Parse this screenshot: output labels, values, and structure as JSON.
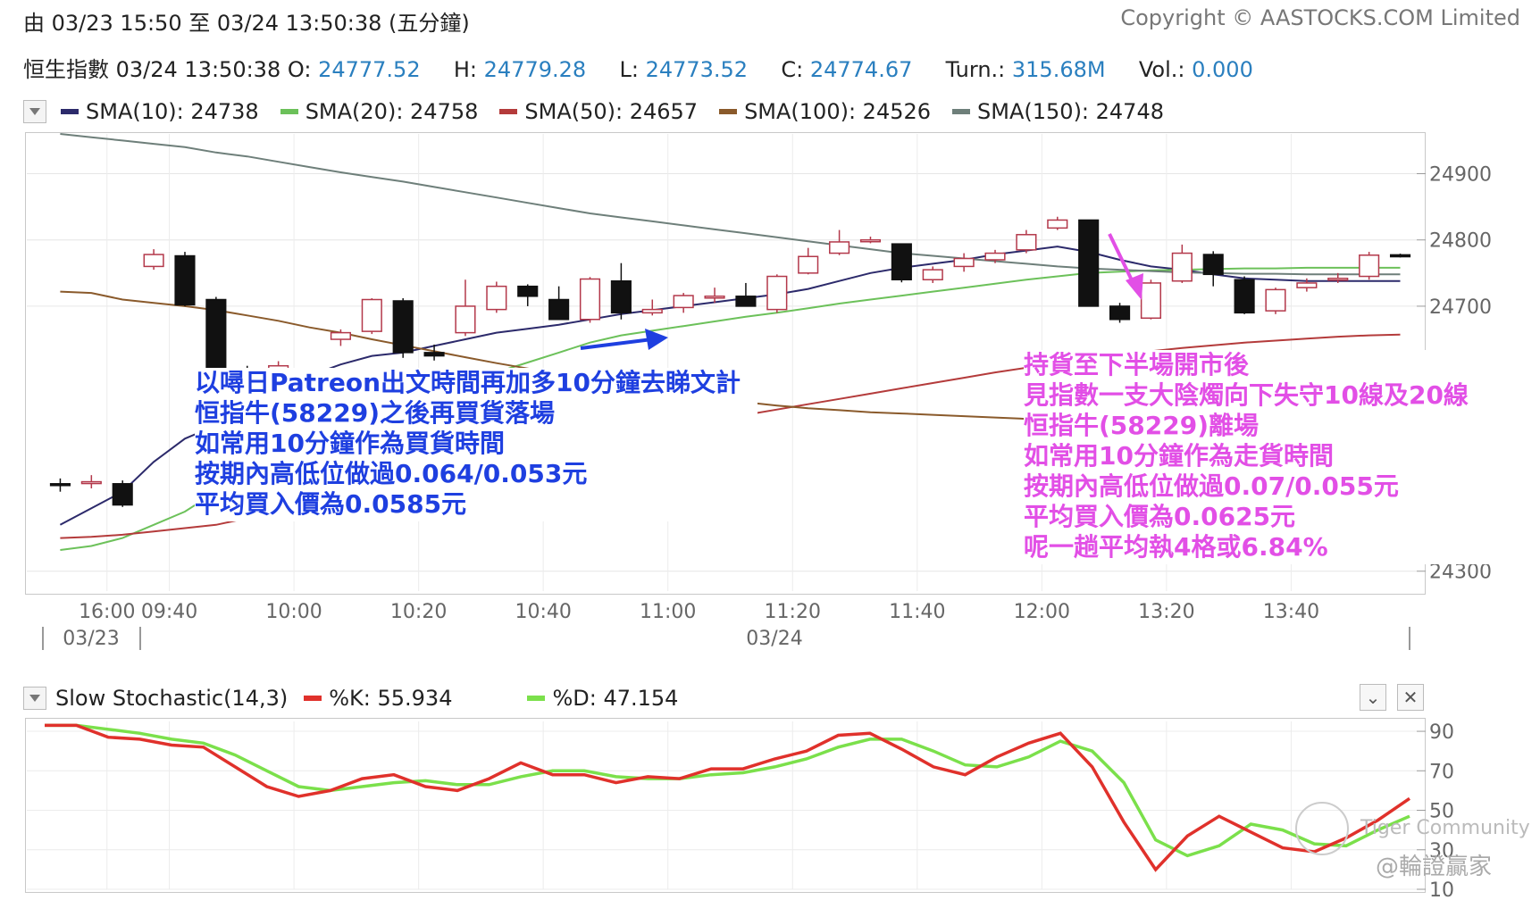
{
  "header": {
    "range_label": "由  03/23 15:50 至  03/24 13:50:38 (五分鐘)",
    "copyright": "Copyright © AASTOCKS.COM Limited"
  },
  "quote": {
    "name": "恒生指數",
    "time": "03/24 13:50:38",
    "open_label": "O:",
    "open": "24777.52",
    "high_label": "H:",
    "high": "24779.28",
    "low_label": "L:",
    "low": "24773.52",
    "close_label": "C:",
    "close": "24774.67",
    "turn_label": "Turn.:",
    "turn": "315.68M",
    "vol_label": "Vol.:",
    "vol": "0.000"
  },
  "sma_legend": [
    {
      "label": "SMA(10): 24738",
      "color": "#2c2a6b"
    },
    {
      "label": "SMA(20): 24758",
      "color": "#6cc15a"
    },
    {
      "label": "SMA(50): 24657",
      "color": "#b43b3b"
    },
    {
      "label": "SMA(100): 24526",
      "color": "#8a5a2b"
    },
    {
      "label": "SMA(150): 24748",
      "color": "#6e7f7a"
    }
  ],
  "stoch_legend": {
    "title": "Slow Stochastic(14,3)",
    "k_label": "%K: 55.934",
    "k_color": "#e0312b",
    "d_label": "%D: 47.154",
    "d_color": "#7be04b"
  },
  "main_axis": {
    "y_ticks": [
      "24900",
      "24800",
      "24700",
      "24300"
    ],
    "x_ticks": [
      "16:00",
      "09:40",
      "10:00",
      "10:20",
      "10:40",
      "11:00",
      "11:20",
      "11:40",
      "12:00",
      "13:20",
      "13:40"
    ],
    "date_labels": [
      "03/23",
      "03/24"
    ]
  },
  "stoch_axis": {
    "y_ticks": [
      "90",
      "70",
      "50",
      "30",
      "10"
    ]
  },
  "annotation_left": {
    "lines": [
      "以噚日Patreon出文時間再加多10分鐘去睇文計",
      "恒指牛(58229)之後再買貨落場",
      "如常用10分鐘作為買貨時間",
      "按期內高低位做過0.064/0.053元",
      "平均買入價為0.0585元"
    ],
    "color": "#1e3fe0"
  },
  "annotation_right": {
    "lines": [
      "持貨至下半場開市後",
      "見指數一支大陰燭向下失守10線及20線",
      "恒指牛(58229)離場",
      "如常用10分鐘作為走貨時間",
      "按期內高低位做過0.07/0.055元",
      "平均買入價為0.0625元",
      "呢一趟平均執4格或6.84%"
    ],
    "color": "#e24fe6"
  },
  "watermarks": {
    "community": "Tiger Community",
    "author": "@輪證贏家"
  },
  "chart_data": [
    {
      "type": "candlestick",
      "title": "恒生指數",
      "ylim": [
        24270,
        24960
      ],
      "x_ticks": [
        "16:00",
        "09:40",
        "10:00",
        "10:20",
        "10:40",
        "11:00",
        "11:20",
        "11:40",
        "12:00",
        "13:20",
        "13:40"
      ],
      "candles": [
        {
          "o": 24432,
          "h": 24440,
          "l": 24420,
          "c": 24430
        },
        {
          "o": 24435,
          "h": 24445,
          "l": 24425,
          "c": 24435
        },
        {
          "o": 24432,
          "h": 24437,
          "l": 24397,
          "c": 24400
        },
        {
          "o": 24760,
          "h": 24786,
          "l": 24755,
          "c": 24778
        },
        {
          "o": 24776,
          "h": 24782,
          "l": 24700,
          "c": 24702
        },
        {
          "o": 24710,
          "h": 24714,
          "l": 24600,
          "c": 24605
        },
        {
          "o": 24600,
          "h": 24610,
          "l": 24540,
          "c": 24545
        },
        {
          "o": 24560,
          "h": 24617,
          "l": 24553,
          "c": 24610
        },
        {
          "o": 24540,
          "h": 24560,
          "l": 24520,
          "c": 24530
        },
        {
          "o": 24650,
          "h": 24665,
          "l": 24640,
          "c": 24660
        },
        {
          "o": 24662,
          "h": 24712,
          "l": 24658,
          "c": 24710
        },
        {
          "o": 24708,
          "h": 24712,
          "l": 24622,
          "c": 24630
        },
        {
          "o": 24630,
          "h": 24642,
          "l": 24618,
          "c": 24625
        },
        {
          "o": 24660,
          "h": 24740,
          "l": 24655,
          "c": 24700
        },
        {
          "o": 24695,
          "h": 24737,
          "l": 24690,
          "c": 24730
        },
        {
          "o": 24730,
          "h": 24733,
          "l": 24700,
          "c": 24715
        },
        {
          "o": 24710,
          "h": 24730,
          "l": 24680,
          "c": 24680
        },
        {
          "o": 24680,
          "h": 24744,
          "l": 24675,
          "c": 24741
        },
        {
          "o": 24738,
          "h": 24765,
          "l": 24680,
          "c": 24690
        },
        {
          "o": 24690,
          "h": 24710,
          "l": 24686,
          "c": 24695
        },
        {
          "o": 24698,
          "h": 24720,
          "l": 24690,
          "c": 24716
        },
        {
          "o": 24714,
          "h": 24728,
          "l": 24705,
          "c": 24715
        },
        {
          "o": 24715,
          "h": 24735,
          "l": 24700,
          "c": 24700
        },
        {
          "o": 24695,
          "h": 24748,
          "l": 24690,
          "c": 24745
        },
        {
          "o": 24750,
          "h": 24788,
          "l": 24748,
          "c": 24775
        },
        {
          "o": 24780,
          "h": 24815,
          "l": 24777,
          "c": 24797
        },
        {
          "o": 24800,
          "h": 24805,
          "l": 24795,
          "c": 24800
        },
        {
          "o": 24794,
          "h": 24794,
          "l": 24736,
          "c": 24740
        },
        {
          "o": 24740,
          "h": 24760,
          "l": 24735,
          "c": 24755
        },
        {
          "o": 24760,
          "h": 24780,
          "l": 24752,
          "c": 24772
        },
        {
          "o": 24770,
          "h": 24785,
          "l": 24765,
          "c": 24780
        },
        {
          "o": 24785,
          "h": 24815,
          "l": 24780,
          "c": 24808
        },
        {
          "o": 24818,
          "h": 24835,
          "l": 24815,
          "c": 24830
        },
        {
          "o": 24830,
          "h": 24830,
          "l": 24700,
          "c": 24700
        },
        {
          "o": 24700,
          "h": 24705,
          "l": 24675,
          "c": 24680
        },
        {
          "o": 24682,
          "h": 24740,
          "l": 24680,
          "c": 24735
        },
        {
          "o": 24738,
          "h": 24793,
          "l": 24735,
          "c": 24780
        },
        {
          "o": 24778,
          "h": 24783,
          "l": 24730,
          "c": 24748
        },
        {
          "o": 24740,
          "h": 24745,
          "l": 24688,
          "c": 24690
        },
        {
          "o": 24693,
          "h": 24728,
          "l": 24688,
          "c": 24725
        },
        {
          "o": 24728,
          "h": 24742,
          "l": 24722,
          "c": 24735
        },
        {
          "o": 24740,
          "h": 24750,
          "l": 24735,
          "c": 24742
        },
        {
          "o": 24745,
          "h": 24782,
          "l": 24740,
          "c": 24777
        },
        {
          "o": 24777.52,
          "h": 24779.28,
          "l": 24773.52,
          "c": 24774.67
        }
      ],
      "sma": {
        "SMA(10)": [
          24370,
          24395,
          24420,
          24465,
          24500,
          24520,
          24540,
          24570,
          24595,
          24612,
          24625,
          24630,
          24640,
          24650,
          24660,
          24666,
          24672,
          24680,
          24688,
          24694,
          24700,
          24706,
          24712,
          24718,
          24726,
          24738,
          24750,
          24758,
          24764,
          24770,
          24778,
          24784,
          24790,
          24782,
          24770,
          24760,
          24755,
          24748,
          24742,
          24740,
          24738,
          24738,
          24738,
          24738
        ],
        "SMA(20)": [
          24332,
          24338,
          24350,
          24370,
          24390,
          24420,
          24450,
          24480,
          24505,
          24525,
          24540,
          24555,
          24570,
          24585,
          24600,
          24615,
          24630,
          24645,
          24656,
          24663,
          24670,
          24677,
          24684,
          24690,
          24697,
          24704,
          24710,
          24716,
          24722,
          24728,
          24734,
          24740,
          24745,
          24750,
          24752,
          24754,
          24755,
          24756,
          24757,
          24757,
          24758,
          24758,
          24758,
          24758
        ],
        "SMA(50)": [
          24350,
          24352,
          24355,
          24360,
          24365,
          24370,
          24380,
          24390,
          24400,
          24410,
          24420,
          24430,
          24440,
          24450,
          24460,
          24470,
          24480,
          24490,
          24500,
          24510,
          24520,
          24528,
          24536,
          24544,
          24552,
          24560,
          24568,
          24576,
          24584,
          24592,
          24600,
          24607,
          24614,
          24621,
          24627,
          24632,
          24637,
          24641,
          24645,
          24648,
          24651,
          24654,
          24656,
          24657
        ],
        "SMA(100)": [
          24722,
          24720,
          24710,
          24705,
          24700,
          24694,
          24686,
          24678,
          24668,
          24660,
          24650,
          24641,
          24632,
          24623,
          24614,
          24606,
          24598,
          24590,
          24580,
          24572,
          24566,
          24560,
          24555,
          24550,
          24546,
          24543,
          24540,
          24538,
          24536,
          24534,
          24532,
          24530,
          24528,
          24527,
          24527,
          24526,
          24526,
          24526,
          24526,
          24526,
          24526,
          24526,
          24526,
          24526
        ],
        "SMA(150)": [
          24960,
          24955,
          24950,
          24945,
          24940,
          24932,
          24926,
          24918,
          24910,
          24902,
          24895,
          24888,
          24880,
          24872,
          24864,
          24856,
          24848,
          24840,
          24834,
          24828,
          24822,
          24816,
          24810,
          24804,
          24798,
          24792,
          24786,
          24780,
          24776,
          24772,
          24768,
          24764,
          24760,
          24757,
          24755,
          24753,
          24751,
          24750,
          24749,
          24749,
          24748,
          24748,
          24748,
          24748
        ]
      }
    },
    {
      "type": "line",
      "title": "Slow Stochastic(14,3)",
      "ylim": [
        10,
        95
      ],
      "y_ticks": [
        90,
        70,
        50,
        30,
        10
      ],
      "series": [
        {
          "name": "%K",
          "values": [
            93,
            93,
            87,
            86,
            83,
            82,
            72,
            62,
            57,
            60,
            66,
            68,
            62,
            60,
            66,
            74,
            68,
            68,
            64,
            67,
            66,
            71,
            71,
            76,
            80,
            88,
            89,
            81,
            72,
            68,
            77,
            84,
            89,
            72,
            44,
            20,
            37,
            47,
            39,
            31,
            29,
            36,
            45,
            56
          ]
        },
        {
          "name": "%D",
          "values": [
            93,
            93,
            91,
            89,
            86,
            84,
            78,
            70,
            62,
            60,
            62,
            64,
            65,
            63,
            63,
            67,
            70,
            70,
            67,
            66,
            66,
            68,
            69,
            72,
            76,
            82,
            86,
            86,
            80,
            73,
            72,
            77,
            85,
            80,
            64,
            35,
            27,
            32,
            43,
            40,
            33,
            32,
            40,
            47
          ]
        }
      ]
    }
  ]
}
